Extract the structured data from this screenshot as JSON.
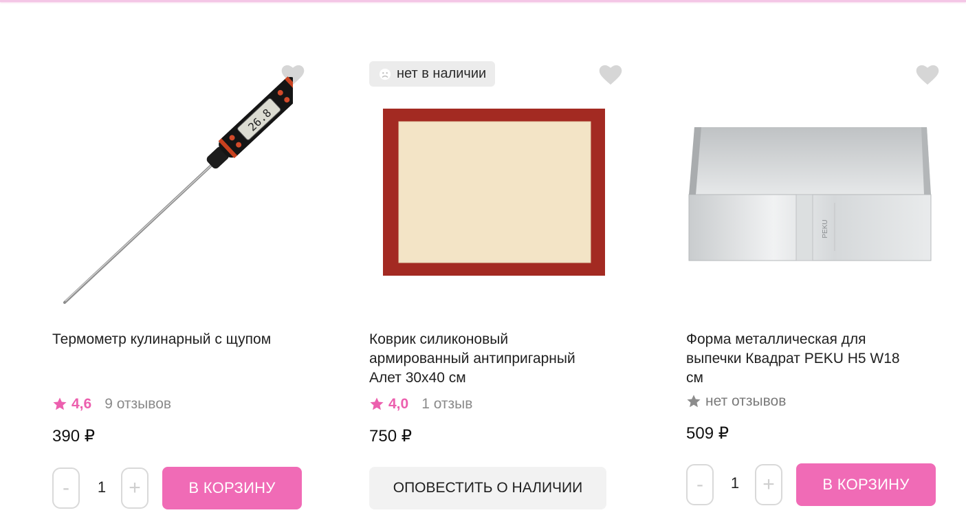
{
  "colors": {
    "accent": "#f06bb6",
    "rating": "#ec5fae",
    "badge_bg": "#ececec",
    "heart": "#d6d6d6"
  },
  "products": [
    {
      "title": "Термометр кулинарный с щупом",
      "rating": "4,6",
      "reviews": "9 отзывов",
      "price": "390 ₽",
      "quantity": "1",
      "minus_label": "-",
      "plus_label": "+",
      "cart_label": "В КОРЗИНУ",
      "icon": "thermometer-image"
    },
    {
      "badge": "нет в наличии",
      "title": "Коврик силиконовый армированный антипригарный Алет 30х40 см",
      "rating": "4,0",
      "reviews": "1 отзыв",
      "price": "750 ₽",
      "notify_label": "ОПОВЕСТИТЬ О НАЛИЧИИ",
      "icon": "baking-mat-image"
    },
    {
      "title": "Форма металлическая для выпечки Квадрат PEKU H5 W18 см",
      "reviews": "нет отзывов",
      "price": "509 ₽",
      "quantity": "1",
      "minus_label": "-",
      "plus_label": "+",
      "cart_label": "В КОРЗИНУ",
      "image_text": "PEKU",
      "icon": "square-form-image"
    }
  ]
}
